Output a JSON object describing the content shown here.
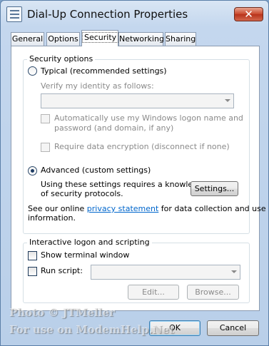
{
  "window": {
    "title": "Dial-Up Connection Properties",
    "close_label": "✕"
  },
  "tabs": [
    {
      "label": "General"
    },
    {
      "label": "Options"
    },
    {
      "label": "Security",
      "active": true
    },
    {
      "label": "Networking"
    },
    {
      "label": "Sharing"
    }
  ],
  "security_options": {
    "group_label": "Security options",
    "typical_label": "Typical (recommended settings)",
    "verify_label": "Verify my identity as follows:",
    "verify_value": "",
    "auto_windows_logon": "Automatically use my Windows logon name and",
    "auto_windows_logon_2": "password (and domain, if any)",
    "require_encryption": "Require data encryption (disconnect if none)",
    "advanced_label": "Advanced (custom settings)",
    "advanced_desc_1": "Using these settings requires a knowledge",
    "advanced_desc_2": "of security protocols.",
    "settings_button": "Settings...",
    "privacy_prefix": "See our online",
    "privacy_link": "privacy statement",
    "privacy_suffix": "for data collection and use",
    "privacy_line2": "information.",
    "selected": "advanced"
  },
  "scripting": {
    "group_label": "Interactive logon and scripting",
    "show_terminal": "Show terminal window",
    "run_script": "Run script:",
    "script_value": "",
    "edit_button": "Edit...",
    "browse_button": "Browse..."
  },
  "footer": {
    "ok_button": "OK",
    "cancel_button": "Cancel"
  },
  "watermark": {
    "line1": "Photo © JTMeller",
    "line2": "For use on ModemHelp.Net"
  }
}
